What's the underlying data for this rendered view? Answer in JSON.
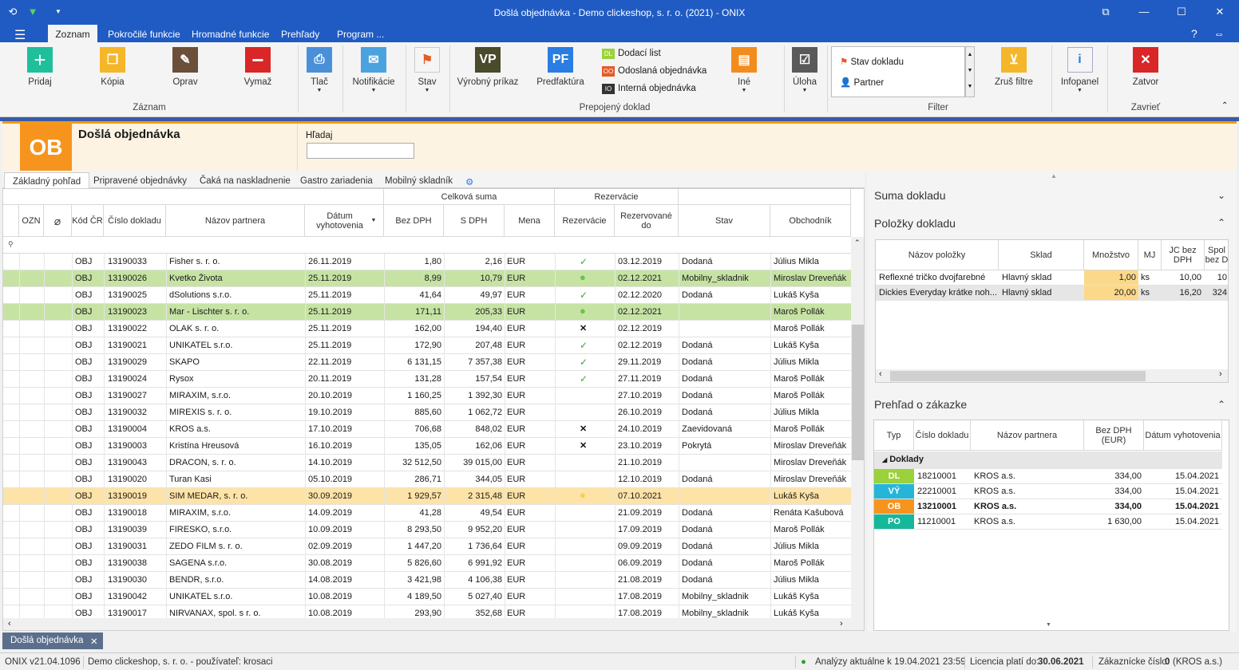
{
  "window": {
    "title": "Došlá objednávka - Demo clickeshop, s. r. o. (2021) - ONIX"
  },
  "menu": {
    "tabs": [
      "Zoznam",
      "Pokročilé funkcie",
      "Hromadné funkcie",
      "Prehľady",
      "Program ..."
    ]
  },
  "ribbon": {
    "zaznam": {
      "label": "Záznam",
      "pridaj": "Pridaj",
      "kopia": "Kópia",
      "oprav": "Oprav",
      "vymaz": "Vymaž"
    },
    "tlac": "Tlač",
    "notifikacie": "Notifikácie",
    "stav": "Stav",
    "vyrobny_prikaz": "Výrobný príkaz",
    "vp": "VP",
    "predfaktura": "Predfaktúra",
    "pf": "PF",
    "dodaci_list": "Dodací list",
    "odoslana_obj": "Odoslaná objednávka",
    "interna_obj": "Interná objednávka",
    "dl": "DL",
    "oo": "OO",
    "io": "IO",
    "ine": "Iné",
    "prepojeny": "Prepojený doklad",
    "uloha": "Úloha",
    "filter_stav": "Stav dokladu",
    "filter_partner": "Partner",
    "filter": "Filter",
    "zrus_filtre": "Zruš filtre",
    "infopanel": "Infopanel",
    "zatvor": "Zatvor",
    "zatvriet": "Zavrieť"
  },
  "header": {
    "badge": "OB",
    "title": "Došlá objednávka",
    "search_label": "Hľadaj",
    "search_value": ""
  },
  "tabs": [
    "Základný pohľad",
    "Pripravené objednávky",
    "Čaká na naskladnenie",
    "Gastro zariadenia",
    "Mobilný skladník"
  ],
  "grid": {
    "group_celkova": "Celková suma",
    "group_rezervacie": "Rezervácie",
    "headers": {
      "ozn": "OZN",
      "kod": "Kód ČR",
      "cislo": "Číslo dokladu",
      "nazov": "Názov partnera",
      "datum": "Dátum vyhotovenia",
      "bez": "Bez DPH",
      "sdph": "S DPH",
      "mena": "Mena",
      "rez": "Rezervácie",
      "rezdo": "Rezervované do",
      "stav": "Stav",
      "obch": "Obchodník"
    },
    "rows": [
      [
        "OBJ",
        "13190033",
        "Fisher s. r. o.",
        "26.11.2019",
        "1,80",
        "2,16",
        "EUR",
        "check",
        "03.12.2019",
        "Dodaná",
        "Július Mikla"
      ],
      [
        "OBJ",
        "13190026",
        "Kvetko Života",
        "25.11.2019",
        "8,99",
        "10,79",
        "EUR",
        "dot",
        "02.12.2021",
        "Mobilny_skladnik",
        "Miroslav Dreveňák"
      ],
      [
        "OBJ",
        "13190025",
        "dSolutions s.r.o.",
        "25.11.2019",
        "41,64",
        "49,97",
        "EUR",
        "check",
        "02.12.2020",
        "Dodaná",
        "Lukáš Kyša"
      ],
      [
        "OBJ",
        "13190023",
        "Mar - Lischter s. r. o.",
        "25.11.2019",
        "171,11",
        "205,33",
        "EUR",
        "dot",
        "02.12.2021",
        "",
        "Maroš Pollák"
      ],
      [
        "OBJ",
        "13190022",
        "OLAK s. r. o.",
        "25.11.2019",
        "162,00",
        "194,40",
        "EUR",
        "x",
        "02.12.2019",
        "",
        "Maroš Pollák"
      ],
      [
        "OBJ",
        "13190021",
        "UNIKATEL s.r.o.",
        "25.11.2019",
        "172,90",
        "207,48",
        "EUR",
        "check",
        "02.12.2019",
        "Dodaná",
        "Lukáš Kyša"
      ],
      [
        "OBJ",
        "13190029",
        "SKAPO",
        "22.11.2019",
        "6 131,15",
        "7 357,38",
        "EUR",
        "check",
        "29.11.2019",
        "Dodaná",
        "Július Mikla"
      ],
      [
        "OBJ",
        "13190024",
        "Rysox",
        "20.11.2019",
        "131,28",
        "157,54",
        "EUR",
        "check",
        "27.11.2019",
        "Dodaná",
        "Maroš Pollák"
      ],
      [
        "OBJ",
        "13190027",
        "MIRAXIM, s.r.o.",
        "20.10.2019",
        "1 160,25",
        "1 392,30",
        "EUR",
        "",
        "27.10.2019",
        "Dodaná",
        "Maroš Pollák"
      ],
      [
        "OBJ",
        "13190032",
        "MIREXIS s. r. o.",
        "19.10.2019",
        "885,60",
        "1 062,72",
        "EUR",
        "",
        "26.10.2019",
        "Dodaná",
        "Július Mikla"
      ],
      [
        "OBJ",
        "13190004",
        "KROS a.s.",
        "17.10.2019",
        "706,68",
        "848,02",
        "EUR",
        "x",
        "24.10.2019",
        "Zaevidovaná",
        "Maroš Pollák"
      ],
      [
        "OBJ",
        "13190003",
        "Kristína Hreusová",
        "16.10.2019",
        "135,05",
        "162,06",
        "EUR",
        "x",
        "23.10.2019",
        "Pokrytá",
        "Miroslav Dreveňák"
      ],
      [
        "OBJ",
        "13190043",
        "DRACON, s. r. o.",
        "14.10.2019",
        "32 512,50",
        "39 015,00",
        "EUR",
        "",
        "21.10.2019",
        "",
        "Miroslav Dreveňák"
      ],
      [
        "OBJ",
        "13190020",
        "Turan Kasi",
        "05.10.2019",
        "286,71",
        "344,05",
        "EUR",
        "",
        "12.10.2019",
        "Dodaná",
        "Miroslav Dreveňák"
      ],
      [
        "OBJ",
        "13190019",
        "SIM MEDAR, s. r. o.",
        "30.09.2019",
        "1 929,57",
        "2 315,48",
        "EUR",
        "dot",
        "07.10.2021",
        "",
        "Lukáš Kyša"
      ],
      [
        "OBJ",
        "13190018",
        "MIRAXIM, s.r.o.",
        "14.09.2019",
        "41,28",
        "49,54",
        "EUR",
        "",
        "21.09.2019",
        "Dodaná",
        "Renáta Kašubová"
      ],
      [
        "OBJ",
        "13190039",
        "FIRESKO, s.r.o.",
        "10.09.2019",
        "8 293,50",
        "9 952,20",
        "EUR",
        "",
        "17.09.2019",
        "Dodaná",
        "Maroš Pollák"
      ],
      [
        "OBJ",
        "13190031",
        "ZEDO FILM s. r. o.",
        "02.09.2019",
        "1 447,20",
        "1 736,64",
        "EUR",
        "",
        "09.09.2019",
        "Dodaná",
        "Július Mikla"
      ],
      [
        "OBJ",
        "13190038",
        "SAGENA s.r.o.",
        "30.08.2019",
        "5 826,60",
        "6 991,92",
        "EUR",
        "",
        "06.09.2019",
        "Dodaná",
        "Maroš Pollák"
      ],
      [
        "OBJ",
        "13190030",
        "BENDR, s.r.o.",
        "14.08.2019",
        "3 421,98",
        "4 106,38",
        "EUR",
        "",
        "21.08.2019",
        "Dodaná",
        "Július Mikla"
      ],
      [
        "OBJ",
        "13190042",
        "UNIKATEL s.r.o.",
        "10.08.2019",
        "4 189,50",
        "5 027,40",
        "EUR",
        "",
        "17.08.2019",
        "Mobilny_skladnik",
        "Lukáš Kyša"
      ],
      [
        "OBJ",
        "13190017",
        "NIRVANAX, spol. s r. o.",
        "10.08.2019",
        "293,90",
        "352,68",
        "EUR",
        "",
        "17.08.2019",
        "Mobilny_skladnik",
        "Lukáš Kyša"
      ]
    ]
  },
  "right": {
    "suma": "Suma dokladu",
    "polozky": "Položky dokladu",
    "prehlad": "Prehľad o zákazke",
    "pol_headers": [
      "Názov položky",
      "Sklad",
      "Množstvo",
      "MJ",
      "JC bez DPH",
      "Spol bez D"
    ],
    "pol_rows": [
      [
        "Reflexné tričko dvojfarebné",
        "Hlavný sklad",
        "1,00",
        "ks",
        "10,00",
        "10"
      ],
      [
        "Dickies Everyday krátke noh...",
        "Hlavný sklad",
        "20,00",
        "ks",
        "16,20",
        "324"
      ]
    ],
    "pre_headers": [
      "Typ",
      "Číslo dokladu",
      "Názov partnera",
      "Bez DPH (EUR)",
      "Dátum vyhotovenia"
    ],
    "group": "Doklady",
    "pre_rows": [
      [
        "DL",
        "18210001",
        "KROS a.s.",
        "334,00",
        "15.04.2021"
      ],
      [
        "VÝ",
        "22210001",
        "KROS a.s.",
        "334,00",
        "15.04.2021"
      ],
      [
        "OB",
        "13210001",
        "KROS a.s.",
        "334,00",
        "15.04.2021"
      ],
      [
        "PO",
        "11210001",
        "KROS a.s.",
        "1 630,00",
        "15.04.2021"
      ]
    ]
  },
  "doctab": "Došlá objednávka",
  "status": {
    "version": "ONIX v21.04.1096",
    "company": "Demo clickeshop, s. r. o. - používateľ: krosaci",
    "analyzy": "Analýzy aktuálne k 19.04.2021 23:59",
    "licencia_label": "Licencia platí do:",
    "licencia": "30.06.2021",
    "zak_label": "Zákaznícke číslo:",
    "zak": "0",
    "zak_suffix": "(KROS a.s.)"
  },
  "colors": {
    "titlebar": "#1f5bc2",
    "accent": "#f7941d",
    "green_row": "#c6e3a4",
    "selected_row": "#fde3a7"
  }
}
